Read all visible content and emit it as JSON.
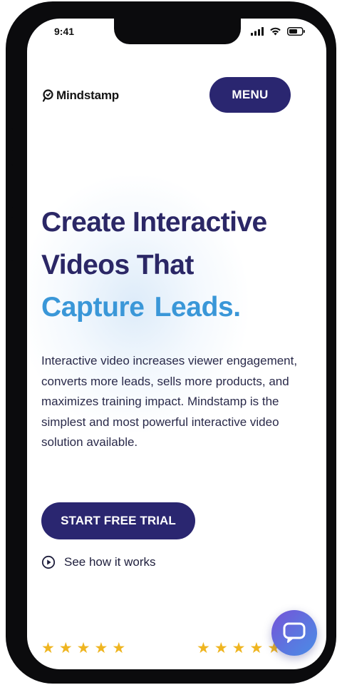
{
  "status_bar": {
    "time": "9:41",
    "icons": [
      "cellular-signal-icon",
      "wifi-icon",
      "battery-icon"
    ]
  },
  "header": {
    "logo_icon": "mindstamp-logo-icon",
    "logo_text": "Mindstamp",
    "menu_label": "MENU"
  },
  "hero": {
    "headline_line1": "Create Interactive",
    "headline_line2": "Videos That",
    "accent_word1": "Capture",
    "accent_word2": "Leads.",
    "description": "Interactive video increases viewer engagement, converts more leads, sells more products, and maximizes training impact. Mindstamp is the simplest and most powerful interactive video solution available.",
    "cta_label": "START FREE TRIAL",
    "secondary_link_icon": "play-circle-icon",
    "secondary_link_label": "See how it works"
  },
  "ratings": {
    "left_stars": 5,
    "right_stars": 5,
    "star_glyph": "★"
  },
  "chat": {
    "icon": "chat-bubble-icon"
  },
  "colors": {
    "brand_navy": "#2a2670",
    "headline": "#2b2766",
    "accent_blue": "#3a97d8",
    "star_gold": "#efb520",
    "chat_gradient_start": "#7553d8",
    "chat_gradient_end": "#4a8ce6"
  }
}
